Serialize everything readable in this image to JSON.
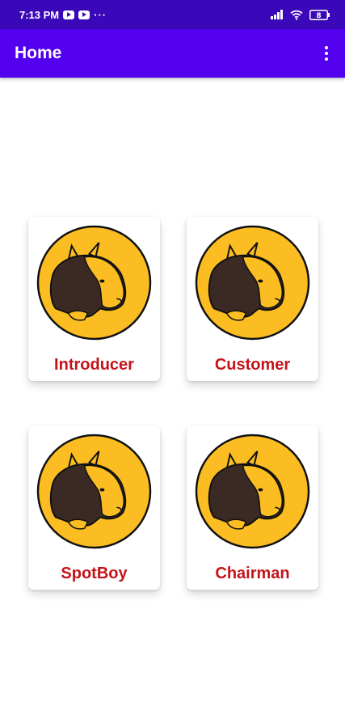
{
  "status_bar": {
    "time": "7:13 PM",
    "left_icons": [
      "youtube-icon",
      "youtube-icon",
      "more-dots-icon"
    ],
    "right_icons": [
      "signal-icon",
      "wifi-icon",
      "battery-icon"
    ],
    "battery_level": "8"
  },
  "app_bar": {
    "title": "Home",
    "menu_icon": "overflow-menu-icon"
  },
  "tiles": [
    {
      "label": "Introducer",
      "icon": "cow-logo-icon"
    },
    {
      "label": "Customer",
      "icon": "cow-logo-icon"
    },
    {
      "label": "SpotBoy",
      "icon": "cow-logo-icon"
    },
    {
      "label": "Chairman",
      "icon": "cow-logo-icon"
    }
  ],
  "colors": {
    "status_bar": "#3a08b8",
    "app_bar": "#5200ee",
    "tile_label": "#c4141a",
    "logo_fill": "#fbbd22",
    "logo_dark": "#3b2a24"
  }
}
